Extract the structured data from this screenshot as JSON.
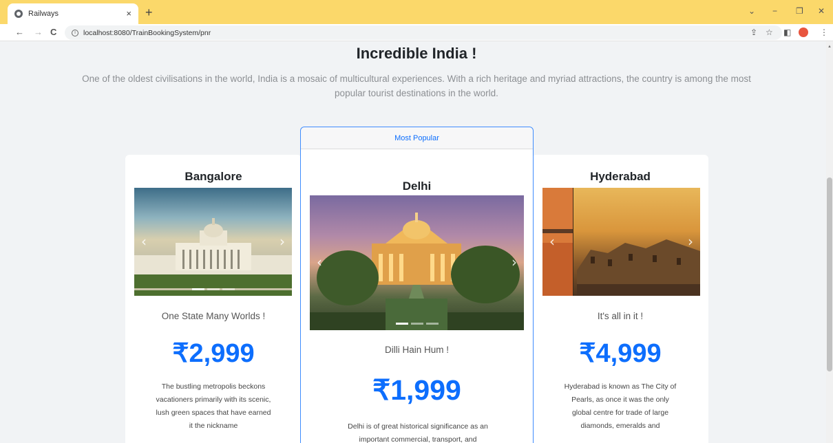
{
  "browser": {
    "tab_title": "Railways",
    "tab_close": "×",
    "new_tab": "+",
    "url": "localhost:8080/TrainBookingSystem/pnr",
    "window_controls": {
      "collapse": "⌄",
      "minimize": "−",
      "restore": "❐",
      "close": "✕"
    },
    "nav": {
      "back": "←",
      "forward": "→",
      "reload": "C"
    },
    "toolbar_icons": {
      "share": "⇪",
      "bookmark": "☆",
      "sidepanel": "◧",
      "menu": "⋮"
    },
    "accent_color": "#fbd86a"
  },
  "page": {
    "heading": "Incredible India !",
    "lead": "One of the oldest civilisations in the world, India is a mosaic of multicultural experiences. With a rich heritage and myriad attractions, the country is among the most popular tourist destinations in the world."
  },
  "cards": {
    "left": {
      "title": "Bangalore",
      "tagline": "One State Many Worlds !",
      "price": "₹2,999",
      "description": "The bustling metropolis beckons vacationers primarily with its scenic, lush green spaces that have earned it the nickname"
    },
    "center": {
      "badge": "Most Popular",
      "title": "Delhi",
      "tagline": "Dilli Hain Hum !",
      "price": "₹1,999",
      "description": "Delhi is of great historical significance as an important commercial, transport, and"
    },
    "right": {
      "title": "Hyderabad",
      "tagline": "It's all in it !",
      "price": "₹4,999",
      "description": "Hyderabad is known as The City of Pearls, as once it was the only global centre for trade of large diamonds, emeralds and"
    }
  },
  "carousel_controls": {
    "prev": "‹",
    "next": "›"
  },
  "colors": {
    "primary": "#0d6efd",
    "page_bg": "#f1f3f5"
  }
}
